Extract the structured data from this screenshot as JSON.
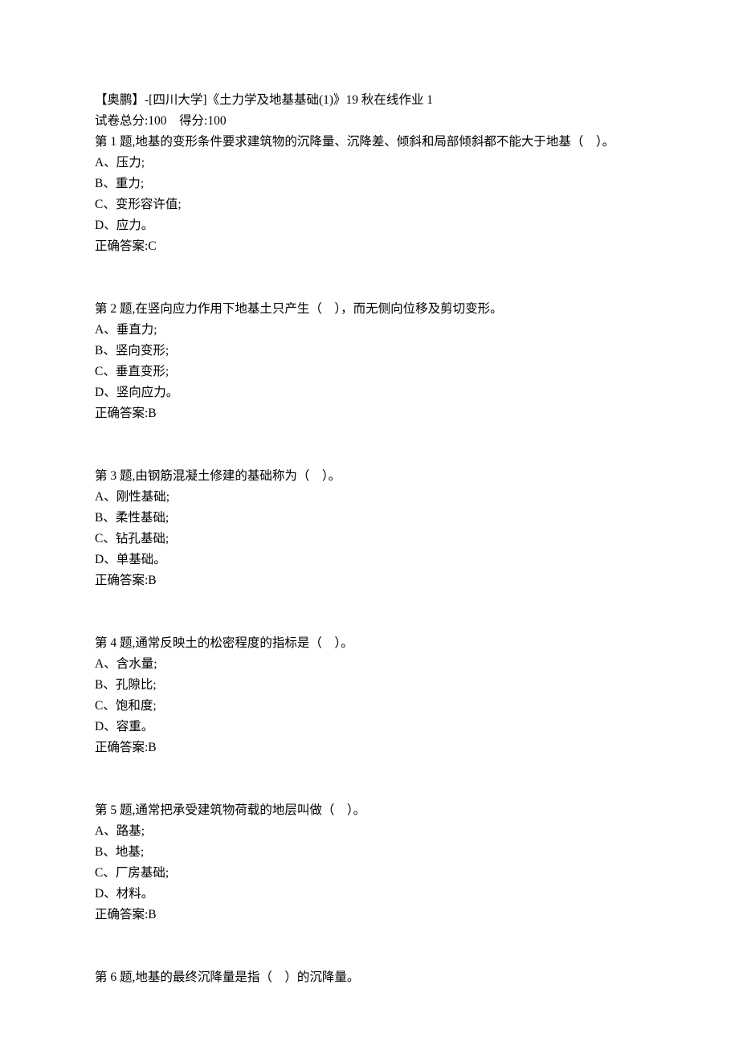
{
  "header": {
    "title": "【奥鹏】-[四川大学]《土力学及地基基础(1)》19 秋在线作业 1",
    "score_line": "试卷总分:100    得分:100"
  },
  "questions": [
    {
      "stem": "第 1 题,地基的变形条件要求建筑物的沉降量、沉降差、倾斜和局部倾斜都不能大于地基（    ）。",
      "options": [
        "A、压力;",
        "B、重力;",
        "C、变形容许值;",
        "D、应力。"
      ],
      "answer": "正确答案:C"
    },
    {
      "stem": "第 2 题,在竖向应力作用下地基土只产生（    ），而无侧向位移及剪切变形。",
      "options": [
        "A、垂直力;",
        "B、竖向变形;",
        "C、垂直变形;",
        "D、竖向应力。"
      ],
      "answer": "正确答案:B"
    },
    {
      "stem": "第 3 题,由钢筋混凝土修建的基础称为（    ）。",
      "options": [
        "A、刚性基础;",
        "B、柔性基础;",
        "C、钻孔基础;",
        "D、单基础。"
      ],
      "answer": "正确答案:B"
    },
    {
      "stem": "第 4 题,通常反映土的松密程度的指标是（    ）。",
      "options": [
        "A、含水量;",
        "B、孔隙比;",
        "C、饱和度;",
        "D、容重。"
      ],
      "answer": "正确答案:B"
    },
    {
      "stem": "第 5 题,通常把承受建筑物荷载的地层叫做（    ）。",
      "options": [
        "A、路基;",
        "B、地基;",
        "C、厂房基础;",
        "D、材料。"
      ],
      "answer": "正确答案:B"
    },
    {
      "stem": "第 6 题,地基的最终沉降量是指（    ）的沉降量。",
      "options": [],
      "answer": ""
    }
  ]
}
